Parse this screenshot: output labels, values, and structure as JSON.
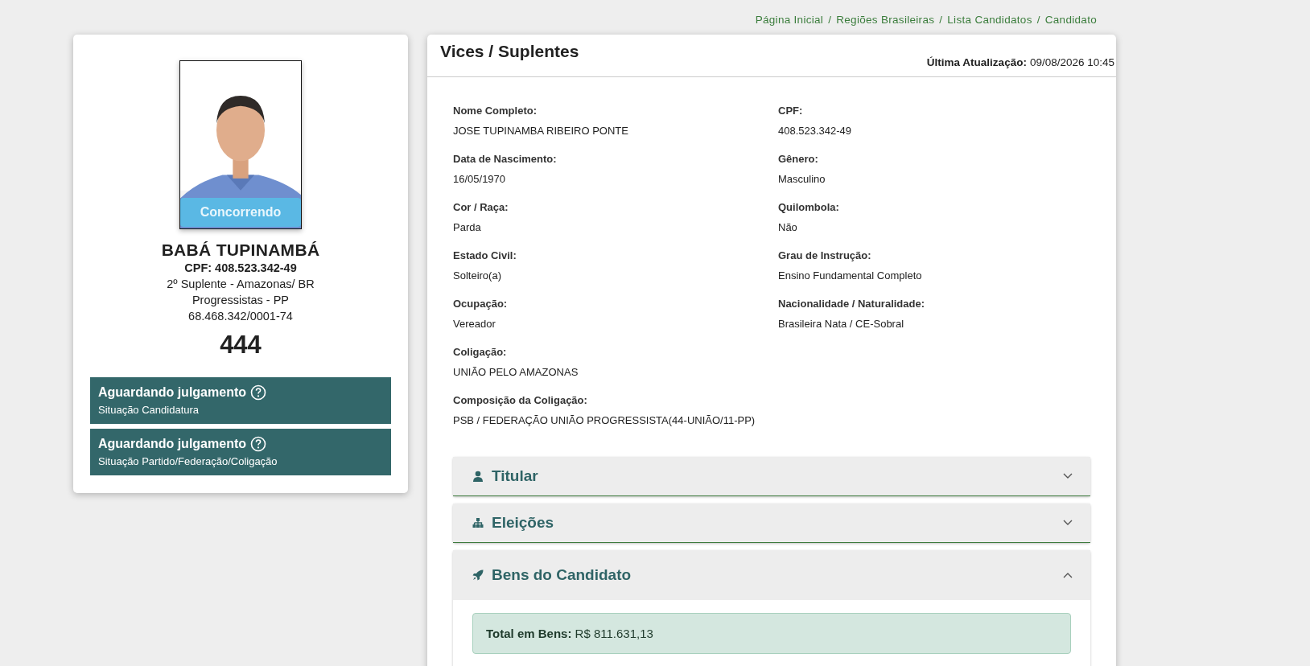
{
  "breadcrumb": [
    "Página Inicial",
    "Regiões Brasileiras",
    "Lista Candidatos",
    "Candidato"
  ],
  "breadcrumb_separator": "/",
  "candidate": {
    "photo_badge": "Concorrendo",
    "name": "BABÁ TUPINAMBÁ",
    "cpf": "CPF: 408.523.342-49",
    "role": "2º Suplente - Amazonas/ BR",
    "party": "Progressistas - PP",
    "cnpj": "68.468.342/0001-74",
    "number": "444",
    "statuses": [
      {
        "title": "Aguardando julgamento",
        "subtitle": "Situação Candidatura"
      },
      {
        "title": "Aguardando julgamento",
        "subtitle": "Situação Partido/Federação/Coligação"
      }
    ]
  },
  "panel": {
    "title": "Vices / Suplentes",
    "updated_label": "Última Atualização:",
    "updated_value": "09/08/2026 10:45",
    "rows": [
      [
        {
          "label": "Nome Completo:",
          "value": "JOSE TUPINAMBA RIBEIRO PONTE"
        },
        {
          "label": "CPF:",
          "value": "408.523.342-49"
        }
      ],
      [
        {
          "label": "Data de Nascimento:",
          "value": "16/05/1970"
        },
        {
          "label": "Gênero:",
          "value": "Masculino"
        }
      ],
      [
        {
          "label": "Cor / Raça:",
          "value": "Parda"
        },
        {
          "label": "Quilombola:",
          "value": "Não"
        }
      ],
      [
        {
          "label": "Estado Civil:",
          "value": "Solteiro(a)"
        },
        {
          "label": "Grau de Instrução:",
          "value": "Ensino Fundamental Completo"
        }
      ],
      [
        {
          "label": "Ocupação:",
          "value": "Vereador"
        },
        {
          "label": "Nacionalidade / Naturalidade:",
          "value": "Brasileira Nata / CE-Sobral"
        }
      ],
      [
        {
          "label": "Coligação:",
          "value": "UNIÃO PELO AMAZONAS"
        }
      ],
      [
        {
          "label": "Composição da Coligação:",
          "value": "PSB / FEDERAÇÃO UNIÃO PROGRESSISTA(44-UNIÃO/11-PP)"
        }
      ]
    ],
    "sections": [
      {
        "kind": "person",
        "title": "Titular",
        "expanded": false
      },
      {
        "kind": "hierarchy",
        "title": "Eleições",
        "expanded": false
      },
      {
        "kind": "rocket",
        "title": "Bens do Candidato",
        "expanded": true,
        "total": "**Total em Bens:** R$ 811.631,13"
      }
    ]
  }
}
